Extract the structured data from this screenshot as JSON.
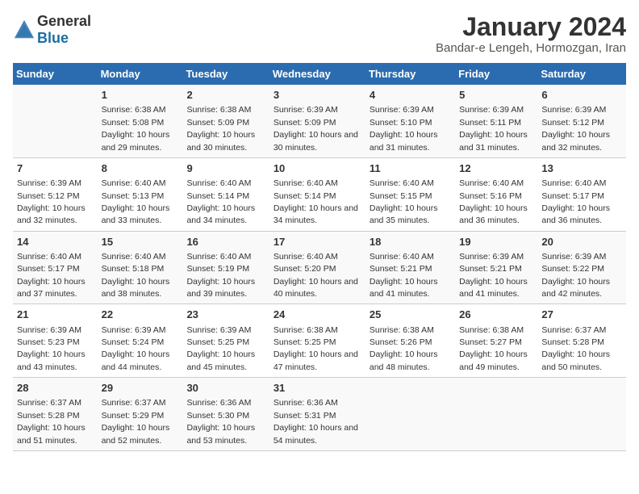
{
  "header": {
    "logo_general": "General",
    "logo_blue": "Blue",
    "title": "January 2024",
    "subtitle": "Bandar-e Lengeh, Hormozgan, Iran"
  },
  "calendar": {
    "days_of_week": [
      "Sunday",
      "Monday",
      "Tuesday",
      "Wednesday",
      "Thursday",
      "Friday",
      "Saturday"
    ],
    "weeks": [
      [
        {
          "day": "",
          "sunrise": "",
          "sunset": "",
          "daylight": ""
        },
        {
          "day": "1",
          "sunrise": "Sunrise: 6:38 AM",
          "sunset": "Sunset: 5:08 PM",
          "daylight": "Daylight: 10 hours and 29 minutes."
        },
        {
          "day": "2",
          "sunrise": "Sunrise: 6:38 AM",
          "sunset": "Sunset: 5:09 PM",
          "daylight": "Daylight: 10 hours and 30 minutes."
        },
        {
          "day": "3",
          "sunrise": "Sunrise: 6:39 AM",
          "sunset": "Sunset: 5:09 PM",
          "daylight": "Daylight: 10 hours and 30 minutes."
        },
        {
          "day": "4",
          "sunrise": "Sunrise: 6:39 AM",
          "sunset": "Sunset: 5:10 PM",
          "daylight": "Daylight: 10 hours and 31 minutes."
        },
        {
          "day": "5",
          "sunrise": "Sunrise: 6:39 AM",
          "sunset": "Sunset: 5:11 PM",
          "daylight": "Daylight: 10 hours and 31 minutes."
        },
        {
          "day": "6",
          "sunrise": "Sunrise: 6:39 AM",
          "sunset": "Sunset: 5:12 PM",
          "daylight": "Daylight: 10 hours and 32 minutes."
        }
      ],
      [
        {
          "day": "7",
          "sunrise": "Sunrise: 6:39 AM",
          "sunset": "Sunset: 5:12 PM",
          "daylight": "Daylight: 10 hours and 32 minutes."
        },
        {
          "day": "8",
          "sunrise": "Sunrise: 6:40 AM",
          "sunset": "Sunset: 5:13 PM",
          "daylight": "Daylight: 10 hours and 33 minutes."
        },
        {
          "day": "9",
          "sunrise": "Sunrise: 6:40 AM",
          "sunset": "Sunset: 5:14 PM",
          "daylight": "Daylight: 10 hours and 34 minutes."
        },
        {
          "day": "10",
          "sunrise": "Sunrise: 6:40 AM",
          "sunset": "Sunset: 5:14 PM",
          "daylight": "Daylight: 10 hours and 34 minutes."
        },
        {
          "day": "11",
          "sunrise": "Sunrise: 6:40 AM",
          "sunset": "Sunset: 5:15 PM",
          "daylight": "Daylight: 10 hours and 35 minutes."
        },
        {
          "day": "12",
          "sunrise": "Sunrise: 6:40 AM",
          "sunset": "Sunset: 5:16 PM",
          "daylight": "Daylight: 10 hours and 36 minutes."
        },
        {
          "day": "13",
          "sunrise": "Sunrise: 6:40 AM",
          "sunset": "Sunset: 5:17 PM",
          "daylight": "Daylight: 10 hours and 36 minutes."
        }
      ],
      [
        {
          "day": "14",
          "sunrise": "Sunrise: 6:40 AM",
          "sunset": "Sunset: 5:17 PM",
          "daylight": "Daylight: 10 hours and 37 minutes."
        },
        {
          "day": "15",
          "sunrise": "Sunrise: 6:40 AM",
          "sunset": "Sunset: 5:18 PM",
          "daylight": "Daylight: 10 hours and 38 minutes."
        },
        {
          "day": "16",
          "sunrise": "Sunrise: 6:40 AM",
          "sunset": "Sunset: 5:19 PM",
          "daylight": "Daylight: 10 hours and 39 minutes."
        },
        {
          "day": "17",
          "sunrise": "Sunrise: 6:40 AM",
          "sunset": "Sunset: 5:20 PM",
          "daylight": "Daylight: 10 hours and 40 minutes."
        },
        {
          "day": "18",
          "sunrise": "Sunrise: 6:40 AM",
          "sunset": "Sunset: 5:21 PM",
          "daylight": "Daylight: 10 hours and 41 minutes."
        },
        {
          "day": "19",
          "sunrise": "Sunrise: 6:39 AM",
          "sunset": "Sunset: 5:21 PM",
          "daylight": "Daylight: 10 hours and 41 minutes."
        },
        {
          "day": "20",
          "sunrise": "Sunrise: 6:39 AM",
          "sunset": "Sunset: 5:22 PM",
          "daylight": "Daylight: 10 hours and 42 minutes."
        }
      ],
      [
        {
          "day": "21",
          "sunrise": "Sunrise: 6:39 AM",
          "sunset": "Sunset: 5:23 PM",
          "daylight": "Daylight: 10 hours and 43 minutes."
        },
        {
          "day": "22",
          "sunrise": "Sunrise: 6:39 AM",
          "sunset": "Sunset: 5:24 PM",
          "daylight": "Daylight: 10 hours and 44 minutes."
        },
        {
          "day": "23",
          "sunrise": "Sunrise: 6:39 AM",
          "sunset": "Sunset: 5:25 PM",
          "daylight": "Daylight: 10 hours and 45 minutes."
        },
        {
          "day": "24",
          "sunrise": "Sunrise: 6:38 AM",
          "sunset": "Sunset: 5:25 PM",
          "daylight": "Daylight: 10 hours and 47 minutes."
        },
        {
          "day": "25",
          "sunrise": "Sunrise: 6:38 AM",
          "sunset": "Sunset: 5:26 PM",
          "daylight": "Daylight: 10 hours and 48 minutes."
        },
        {
          "day": "26",
          "sunrise": "Sunrise: 6:38 AM",
          "sunset": "Sunset: 5:27 PM",
          "daylight": "Daylight: 10 hours and 49 minutes."
        },
        {
          "day": "27",
          "sunrise": "Sunrise: 6:37 AM",
          "sunset": "Sunset: 5:28 PM",
          "daylight": "Daylight: 10 hours and 50 minutes."
        }
      ],
      [
        {
          "day": "28",
          "sunrise": "Sunrise: 6:37 AM",
          "sunset": "Sunset: 5:28 PM",
          "daylight": "Daylight: 10 hours and 51 minutes."
        },
        {
          "day": "29",
          "sunrise": "Sunrise: 6:37 AM",
          "sunset": "Sunset: 5:29 PM",
          "daylight": "Daylight: 10 hours and 52 minutes."
        },
        {
          "day": "30",
          "sunrise": "Sunrise: 6:36 AM",
          "sunset": "Sunset: 5:30 PM",
          "daylight": "Daylight: 10 hours and 53 minutes."
        },
        {
          "day": "31",
          "sunrise": "Sunrise: 6:36 AM",
          "sunset": "Sunset: 5:31 PM",
          "daylight": "Daylight: 10 hours and 54 minutes."
        },
        {
          "day": "",
          "sunrise": "",
          "sunset": "",
          "daylight": ""
        },
        {
          "day": "",
          "sunrise": "",
          "sunset": "",
          "daylight": ""
        },
        {
          "day": "",
          "sunrise": "",
          "sunset": "",
          "daylight": ""
        }
      ]
    ]
  }
}
